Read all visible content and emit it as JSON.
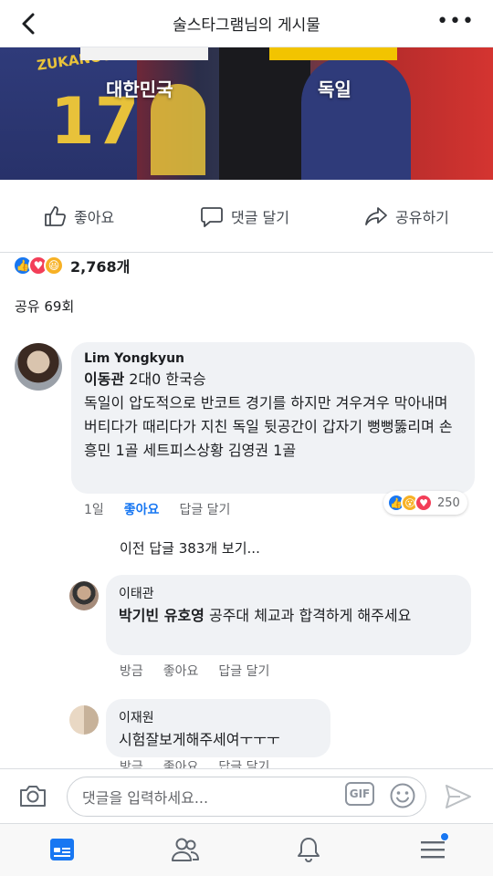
{
  "header": {
    "title": "술스타그램님의 게시물"
  },
  "hero": {
    "team_left": "대한민국",
    "team_right": "독일"
  },
  "actions": {
    "like": "좋아요",
    "comment": "댓글 달기",
    "share": "공유하기"
  },
  "summary": {
    "reaction_count": "2,768개",
    "shares": "공유 69회"
  },
  "comments": [
    {
      "author": "Lim Yongkyun",
      "mention": "이동관",
      "text": " 2대0 한국승\n독일이 압도적으로 반코트 경기를 하지만 겨우겨우 막아내며 버티다가 때리다가 지친 독일 뒷공간이 갑자기 뻥뻥뚫리며 손흥민 1골 세트피스상황 김영권 1골",
      "time": "1일",
      "like": "좋아요",
      "reply": "답글 달기",
      "reactions": "250"
    }
  ],
  "previous_replies": "이전 답글 383개 보기...",
  "replies": [
    {
      "author": "이태관",
      "mention": "박기빈 유호영",
      "text": " 공주대 체교과 합격하게 해주세요",
      "time": "방금",
      "like": "좋아요",
      "reply": "답글 달기"
    },
    {
      "author": "이재원",
      "text": "시험잘보게해주세여ㅜㅜㅜ",
      "time": "방금",
      "like": "좋아요",
      "reply": "답글 달기"
    }
  ],
  "input": {
    "placeholder": "댓글을 입력하세요...",
    "gif": "GIF"
  },
  "colors": {
    "accent": "#1877f2",
    "love": "#f33e58",
    "bubble": "#f0f2f5"
  }
}
